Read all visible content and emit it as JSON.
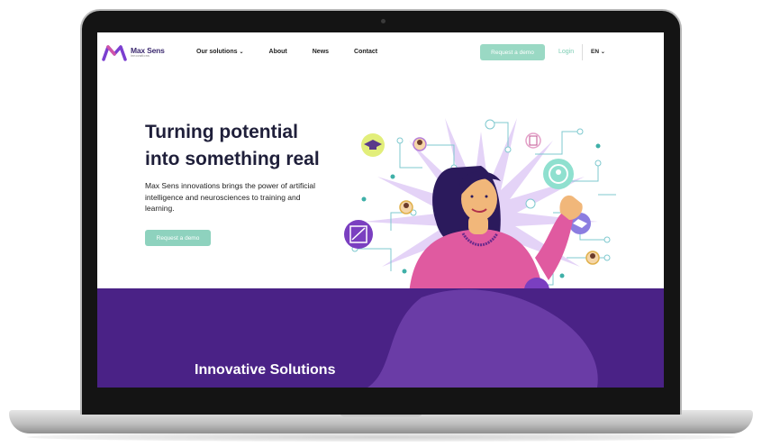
{
  "brand": {
    "name": "Max Sens",
    "tagline": "innovations",
    "colors": {
      "purple": "#4a2286",
      "mint": "#9ad9c4",
      "dark": "#1f1f3a"
    }
  },
  "nav": {
    "items": [
      {
        "label": "Our solutions",
        "has_dropdown": true
      },
      {
        "label": "About",
        "has_dropdown": false
      },
      {
        "label": "News",
        "has_dropdown": false
      },
      {
        "label": "Contact",
        "has_dropdown": false
      }
    ],
    "cta_label": "Request a demo",
    "login_label": "Login",
    "lang_label": "EN"
  },
  "hero": {
    "title_line1": "Turning potential",
    "title_line2": "into something real",
    "description": "Max Sens innovations brings the power of artificial intelligence and neurosciences to training and learning.",
    "cta_label": "Request a demo"
  },
  "section": {
    "title": "Innovative Solutions"
  }
}
